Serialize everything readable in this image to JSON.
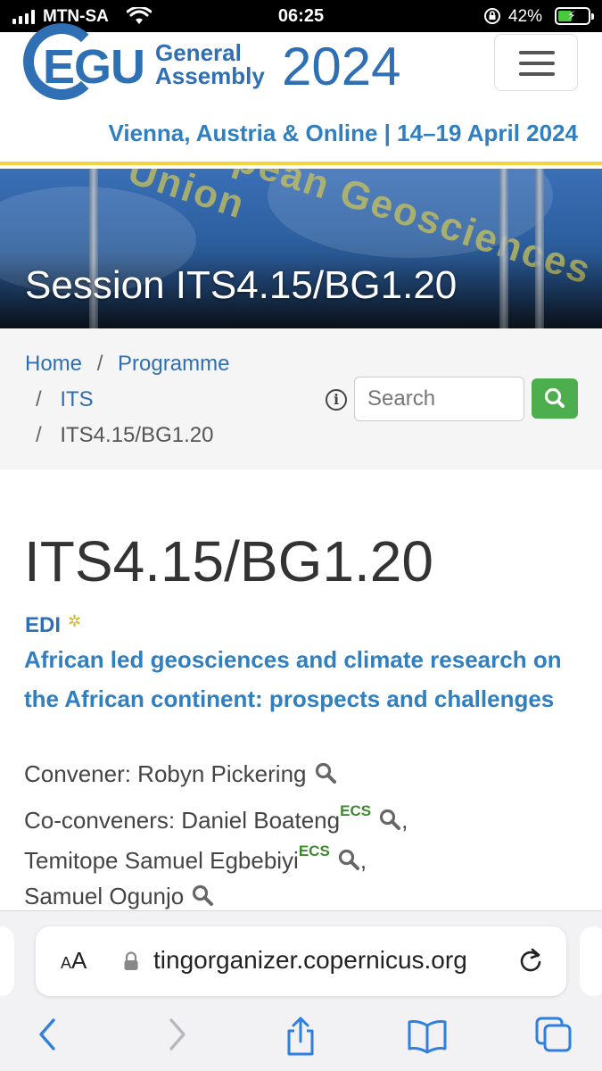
{
  "status_bar": {
    "carrier": "MTN-SA",
    "time": "06:25",
    "battery_percent": "42%",
    "icons": [
      "signal-icon",
      "wifi-icon",
      "orientation-lock-icon",
      "battery-charging-icon"
    ]
  },
  "header": {
    "logo_egu": "EGU",
    "logo_line1": "General",
    "logo_line2": "Assembly",
    "logo_year": "2024",
    "tagline": "Vienna, Austria & Online | 14–19 April 2024",
    "menu_icon": "hamburger-menu-icon"
  },
  "banner": {
    "flag_text": "European Geosciences Union",
    "title": "Session ITS4.15/BG1.20"
  },
  "breadcrumb": {
    "home": "Home",
    "programme": "Programme",
    "its": "ITS",
    "current": "ITS4.15/BG1.20",
    "separator": "/"
  },
  "search": {
    "placeholder": "Search",
    "info_symbol": "i",
    "button_icon": "search-icon"
  },
  "session": {
    "code": "ITS4.15/BG1.20",
    "badge": "EDI",
    "title": "African led geosciences and climate research on the African continent: prospects and challenges",
    "convener_label": "Convener: Robyn Pickering",
    "coconveners_label": "Co-conveners: Daniel Boateng",
    "ecs_tag": "ECS",
    "coconvener2": "Temitope Samuel Egbebiyi",
    "coconvener3": "Samuel Ogunjo",
    "comma": ","
  },
  "browser": {
    "text_size_label_small": "A",
    "text_size_label_large": "A",
    "url": "tingorganizer.copernicus.org",
    "icons": [
      "lock-icon",
      "reload-icon",
      "back-icon",
      "forward-icon",
      "share-icon",
      "bookmarks-icon",
      "tabs-icon"
    ]
  },
  "colors": {
    "egu_blue": "#2f6fb3",
    "link_blue": "#2f7fc1",
    "accent_yellow": "#f5d442",
    "search_green": "#4cae4c",
    "ecs_green": "#3d8b2f"
  }
}
